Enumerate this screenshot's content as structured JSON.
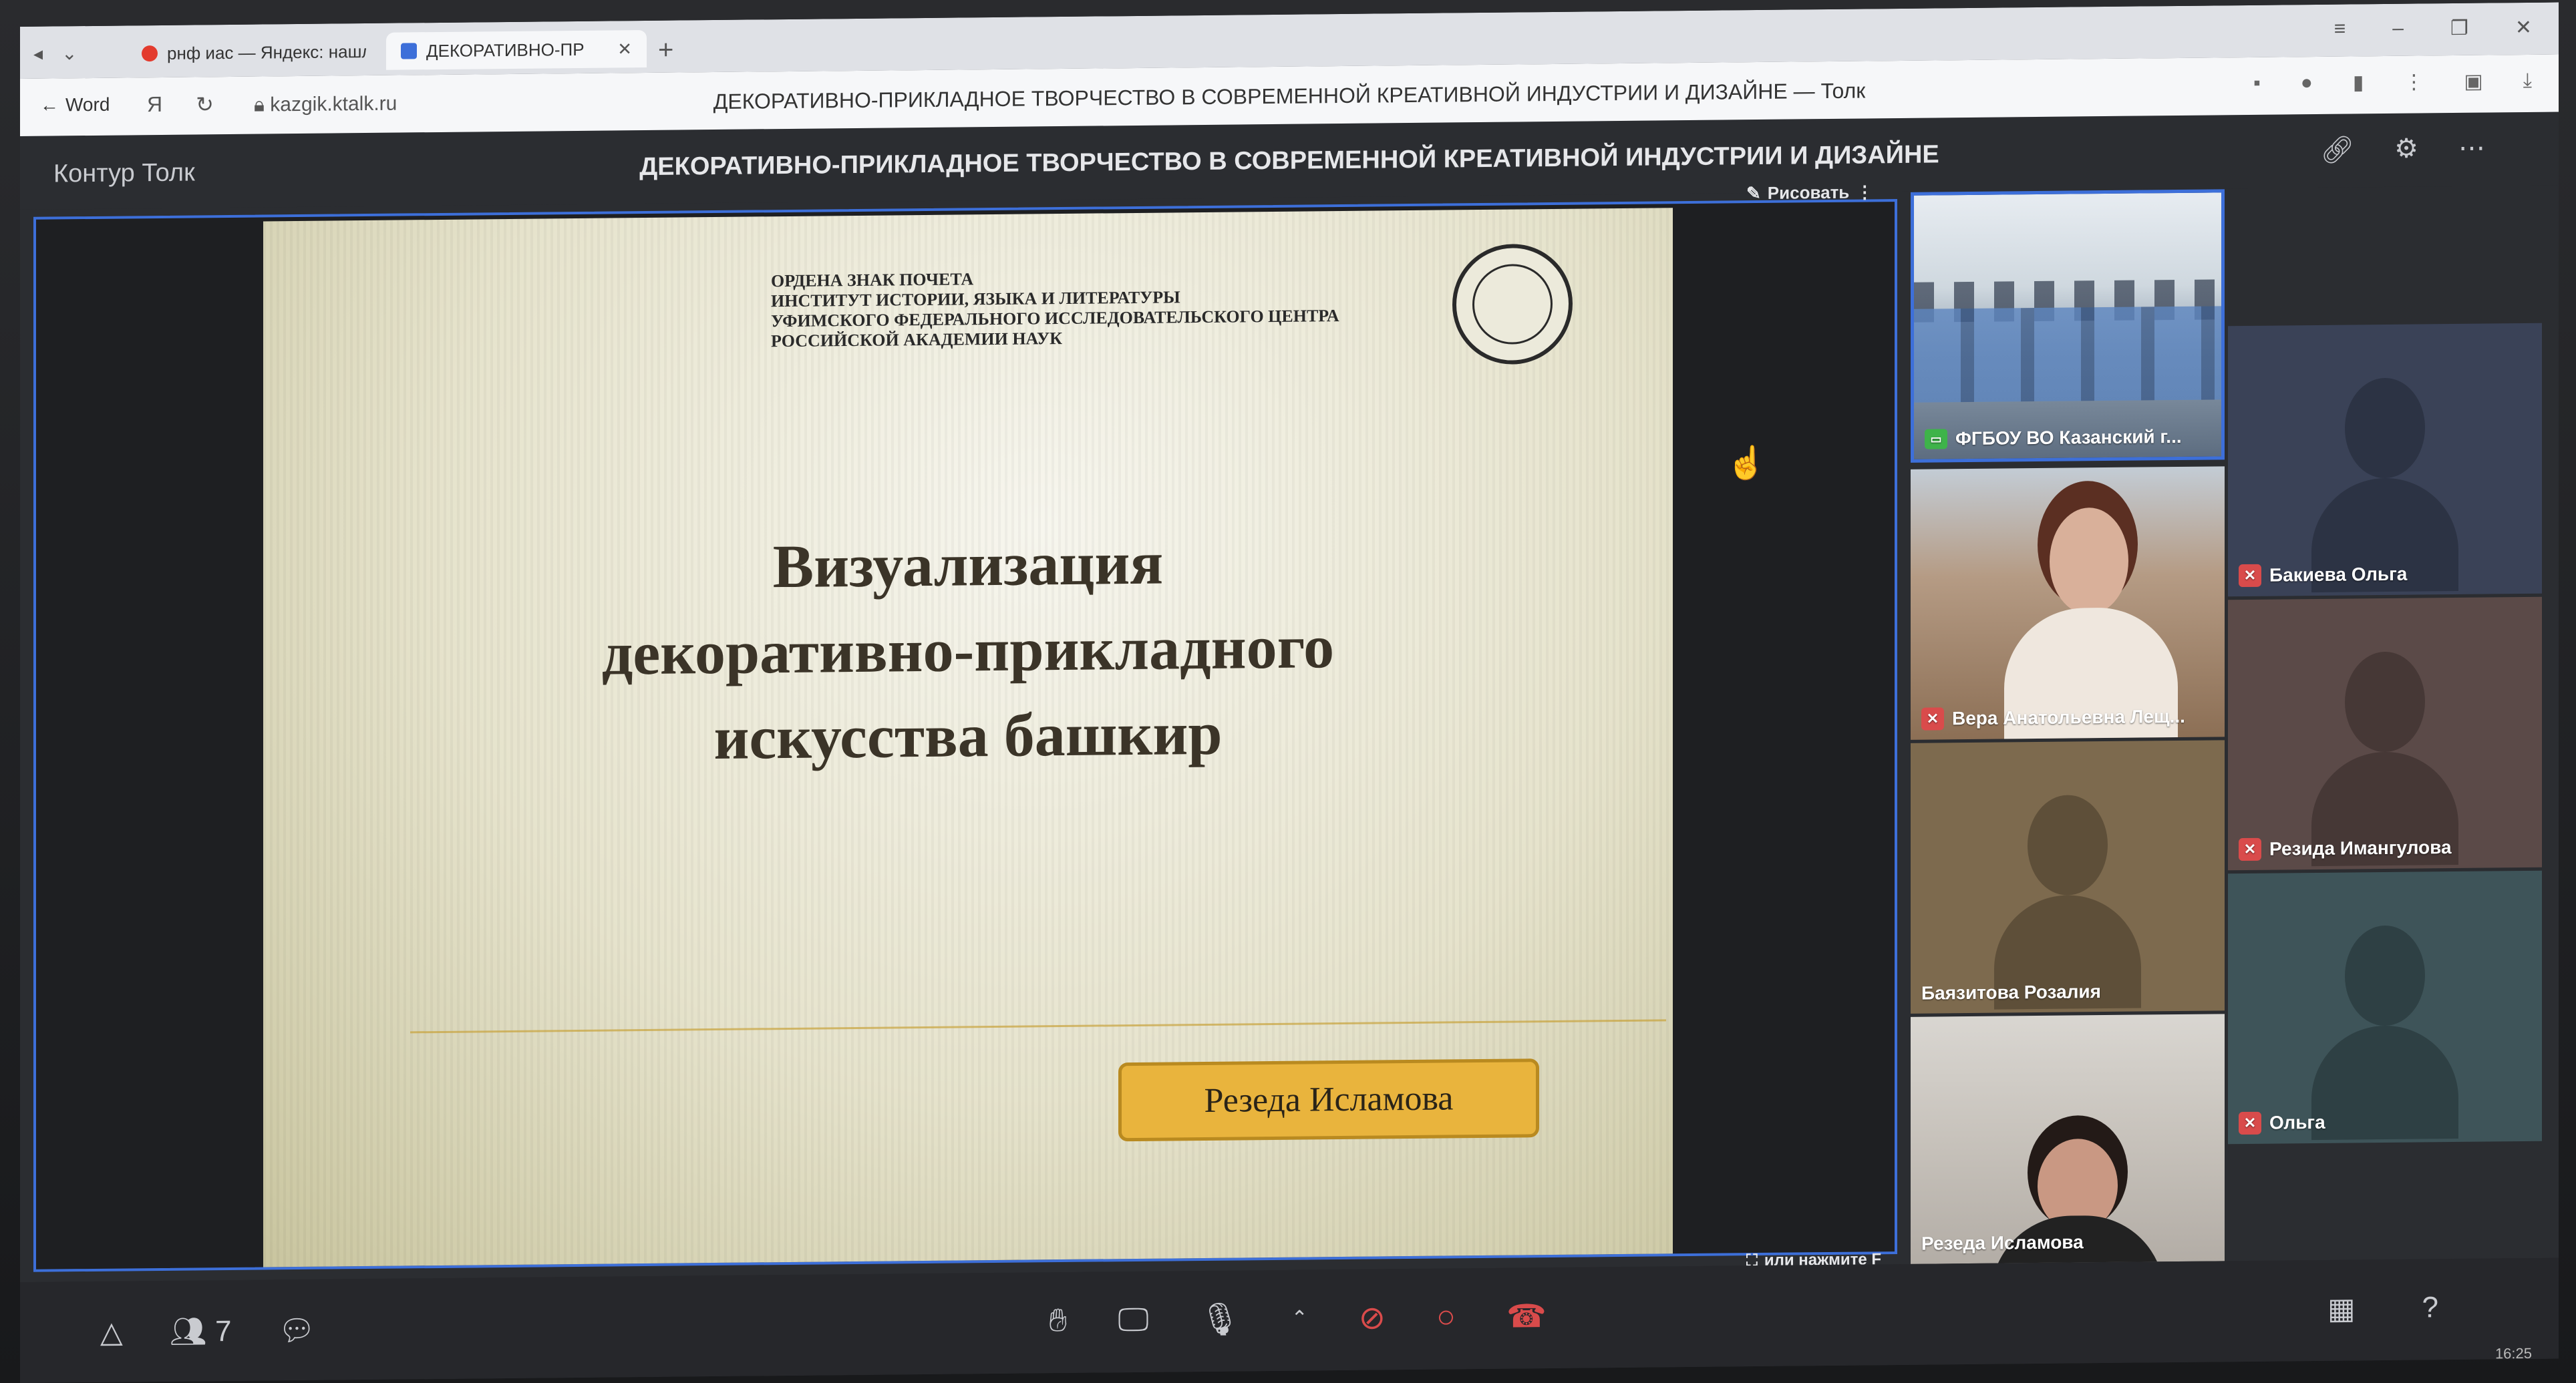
{
  "browser": {
    "tabs": [
      {
        "label": "рнф иас — Яндекс: нашл",
        "active": false
      },
      {
        "label": "ДЕКОРАТИВНО-ПР",
        "active": true
      }
    ],
    "back_label": "Word",
    "url": "kazgik.ktalk.ru",
    "page_title": "ДЕКОРАТИВНО-ПРИКЛАДНОЕ ТВОРЧЕСТВО В СОВРЕМЕННОЙ КРЕАТИВНОЙ ИНДУСТРИИ И ДИЗАЙНЕ — Толк"
  },
  "app": {
    "brand": "Контур Толк",
    "conference_title": "ДЕКОРАТИВНО-ПРИКЛАДНОЕ ТВОРЧЕСТВО В СОВРЕМЕННОЙ КРЕАТИВНОЙ ИНДУСТРИИ И ДИЗАЙНЕ",
    "draw_label": "Рисовать",
    "fullscreen_hint": "или нажмите F"
  },
  "slide": {
    "institution_lines": [
      "ОРДЕНА ЗНАК ПОЧЕТА",
      "ИНСТИТУТ ИСТОРИИ, ЯЗЫКА И ЛИТЕРАТУРЫ",
      "УФИМСКОГО ФЕДЕРАЛЬНОГО ИССЛЕДОВАТЕЛЬСКОГО ЦЕНТРА",
      "РОССИЙСКОЙ АКАДЕМИИ НАУК"
    ],
    "title_lines": [
      "Визуализация",
      "декоративно-прикладного",
      "искусства башкир"
    ],
    "author": "Резеда Исламова"
  },
  "participants": [
    {
      "name": "ФГБОУ ВО Казанский г...",
      "status": "screen"
    },
    {
      "name": "Вера Анатольевна Лещ...",
      "status": "muted"
    },
    {
      "name": "Бакиева Ольга",
      "status": "muted"
    },
    {
      "name": "Баязитова Розалия",
      "status": "none"
    },
    {
      "name": "Резида Имангулова",
      "status": "muted"
    },
    {
      "name": "Резеда Исламова",
      "status": "none"
    },
    {
      "name": "Ольга",
      "status": "muted"
    }
  ],
  "toolbar": {
    "participants_count": "7"
  },
  "status": {
    "clock": "16:25"
  },
  "colors": {
    "accent_border": "#3d6fd9",
    "author_badge": "#e9b43d",
    "muted_red": "#d94b4b",
    "screen_share_green": "#3eb34a"
  }
}
